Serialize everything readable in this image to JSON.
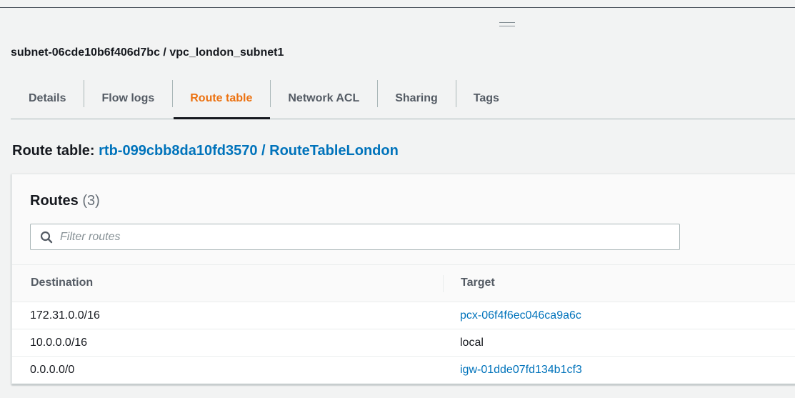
{
  "header": {
    "title": "subnet-06cde10b6f406d7bc / vpc_london_subnet1"
  },
  "tabs": [
    {
      "label": "Details"
    },
    {
      "label": "Flow logs"
    },
    {
      "label": "Route table",
      "active": true
    },
    {
      "label": "Network ACL"
    },
    {
      "label": "Sharing"
    },
    {
      "label": "Tags"
    }
  ],
  "route_table": {
    "label": "Route table:",
    "link": "rtb-099cbb8da10fd3570 / RouteTableLondon"
  },
  "routes": {
    "title": "Routes",
    "count": "(3)",
    "filter_placeholder": "Filter routes",
    "columns": [
      "Destination",
      "Target"
    ],
    "rows": [
      {
        "destination": "172.31.0.0/16",
        "target": "pcx-06f4f6ec046ca9a6c",
        "target_link": true
      },
      {
        "destination": "10.0.0.0/16",
        "target": "local",
        "target_link": false
      },
      {
        "destination": "0.0.0.0/0",
        "target": "igw-01dde07fd134b1cf3",
        "target_link": true
      }
    ]
  },
  "colors": {
    "accent": "#ec7211",
    "link": "#0073bb"
  }
}
